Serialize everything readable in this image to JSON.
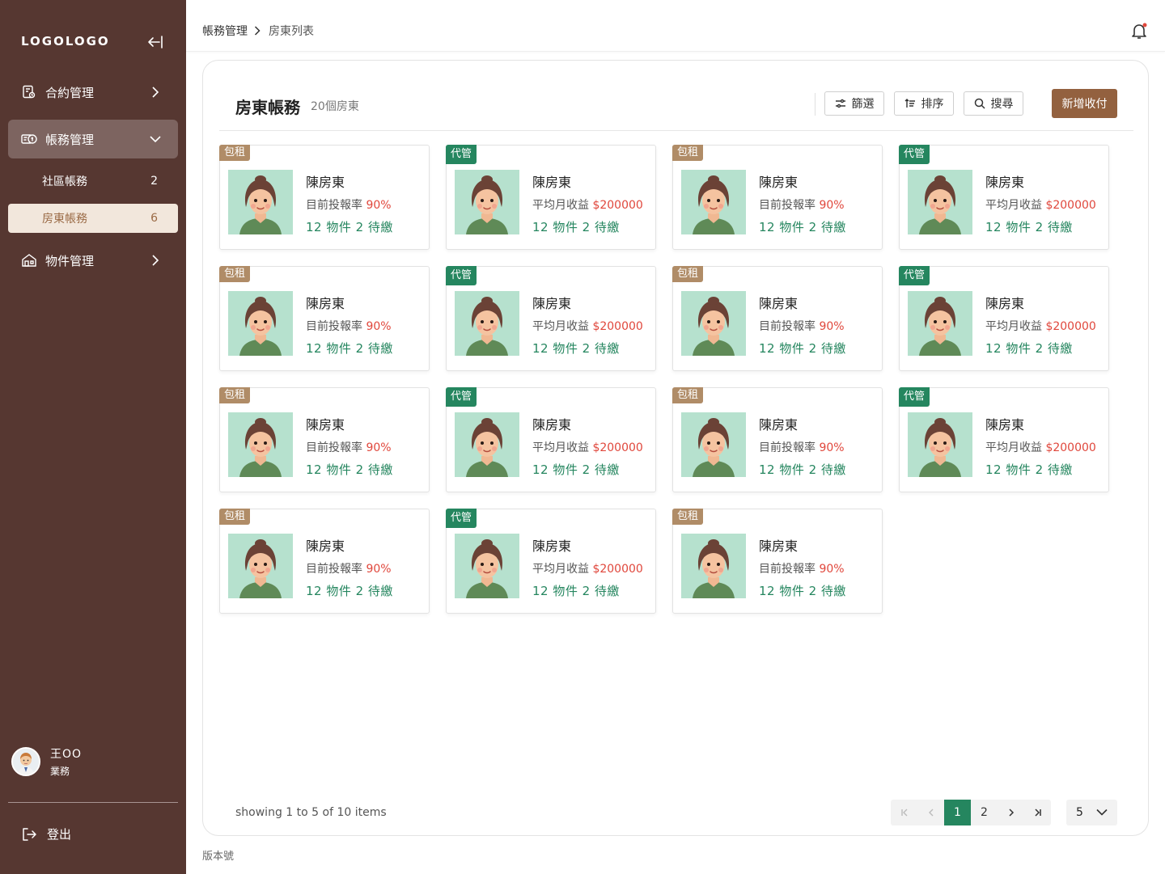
{
  "sidebar": {
    "logo": "LOGOLOGO",
    "nav": [
      {
        "label": "合約管理"
      },
      {
        "label": "帳務管理"
      },
      {
        "label": "物件管理"
      }
    ],
    "sub": [
      {
        "label": "社區帳務",
        "count": "2"
      },
      {
        "label": "房東帳務",
        "count": "6"
      }
    ],
    "user": {
      "name": "王OO",
      "role": "業務"
    },
    "logout": "登出"
  },
  "header": {
    "breadcrumb": [
      "帳務管理",
      "房東列表"
    ]
  },
  "main": {
    "title": "房東帳務",
    "subtitle": "20個房東",
    "buttons": {
      "filter": "篩選",
      "sort": "排序",
      "search": "搜尋",
      "add": "新增收付"
    },
    "cards": [
      {
        "tag": "包租",
        "type": "lease",
        "name": "陳房東",
        "metric_label": "目前投報率",
        "metric_value": "90%",
        "stats": "12 物件 2 待繳"
      },
      {
        "tag": "代管",
        "type": "manage",
        "name": "陳房東",
        "metric_label": "平均月收益",
        "metric_value": "$200000",
        "stats": "12 物件 2 待繳"
      },
      {
        "tag": "包租",
        "type": "lease",
        "name": "陳房東",
        "metric_label": "目前投報率",
        "metric_value": "90%",
        "stats": "12 物件 2 待繳"
      },
      {
        "tag": "代管",
        "type": "manage",
        "name": "陳房東",
        "metric_label": "平均月收益",
        "metric_value": "$200000",
        "stats": "12 物件 2 待繳"
      },
      {
        "tag": "包租",
        "type": "lease",
        "name": "陳房東",
        "metric_label": "目前投報率",
        "metric_value": "90%",
        "stats": "12 物件 2 待繳"
      },
      {
        "tag": "代管",
        "type": "manage",
        "name": "陳房東",
        "metric_label": "平均月收益",
        "metric_value": "$200000",
        "stats": "12 物件 2 待繳"
      },
      {
        "tag": "包租",
        "type": "lease",
        "name": "陳房東",
        "metric_label": "目前投報率",
        "metric_value": "90%",
        "stats": "12 物件 2 待繳"
      },
      {
        "tag": "代管",
        "type": "manage",
        "name": "陳房東",
        "metric_label": "平均月收益",
        "metric_value": "$200000",
        "stats": "12 物件 2 待繳"
      },
      {
        "tag": "包租",
        "type": "lease",
        "name": "陳房東",
        "metric_label": "目前投報率",
        "metric_value": "90%",
        "stats": "12 物件 2 待繳"
      },
      {
        "tag": "代管",
        "type": "manage",
        "name": "陳房東",
        "metric_label": "平均月收益",
        "metric_value": "$200000",
        "stats": "12 物件 2 待繳"
      },
      {
        "tag": "包租",
        "type": "lease",
        "name": "陳房東",
        "metric_label": "目前投報率",
        "metric_value": "90%",
        "stats": "12 物件 2 待繳"
      },
      {
        "tag": "代管",
        "type": "manage",
        "name": "陳房東",
        "metric_label": "平均月收益",
        "metric_value": "$200000",
        "stats": "12 物件 2 待繳"
      },
      {
        "tag": "包租",
        "type": "lease",
        "name": "陳房東",
        "metric_label": "目前投報率",
        "metric_value": "90%",
        "stats": "12 物件 2 待繳"
      },
      {
        "tag": "代管",
        "type": "manage",
        "name": "陳房東",
        "metric_label": "平均月收益",
        "metric_value": "$200000",
        "stats": "12 物件 2 待繳"
      },
      {
        "tag": "包租",
        "type": "lease",
        "name": "陳房東",
        "metric_label": "目前投報率",
        "metric_value": "90%",
        "stats": "12 物件 2 待繳"
      }
    ],
    "showing": "showing 1 to 5 of 10 items",
    "pagination": {
      "pages": [
        "1",
        "2"
      ],
      "current": "1",
      "page_size": "5"
    }
  },
  "footer": {
    "version": "版本號"
  },
  "colors": {
    "sidebar": "#563731",
    "accent_green": "#25865f",
    "accent_brown": "#93613f",
    "tag_brown": "#b08c67",
    "metric_red": "#e0473c"
  }
}
